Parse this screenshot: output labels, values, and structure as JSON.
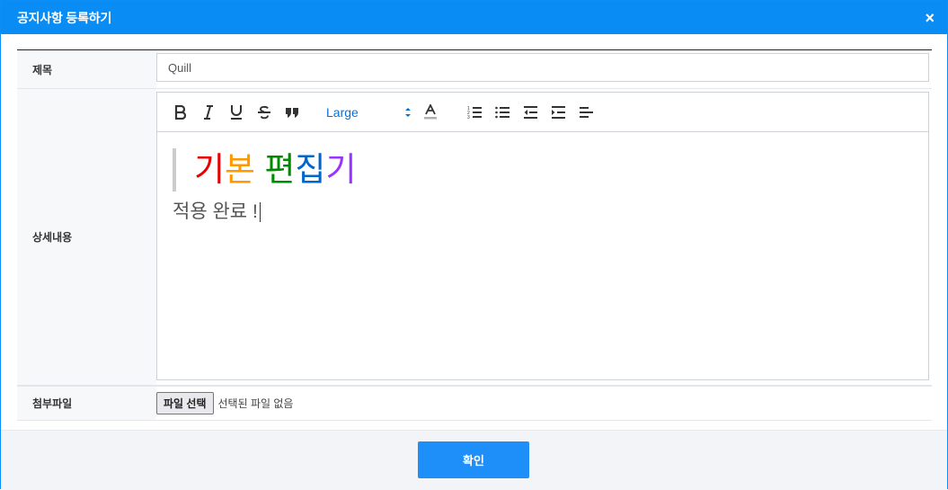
{
  "modal": {
    "title": "공지사항 등록하기",
    "close_glyph": "×"
  },
  "form": {
    "title_label": "제목",
    "title_value": "Quill",
    "content_label": "상세내용",
    "attachment_label": "첨부파일"
  },
  "toolbar": {
    "size_selected": "Large",
    "icons": [
      "bold-icon",
      "italic-icon",
      "underline-icon",
      "strike-icon",
      "blockquote-icon",
      "font-color-icon",
      "ordered-list-icon",
      "bullet-list-icon",
      "outdent-icon",
      "indent-icon",
      "align-icon"
    ]
  },
  "editor": {
    "quote_chars": [
      {
        "text": "기",
        "color": "#e60000"
      },
      {
        "text": "본",
        "color": "#ff9900"
      },
      {
        "text": " ",
        "color": "#000000"
      },
      {
        "text": "편",
        "color": "#008a00"
      },
      {
        "text": "집",
        "color": "#0066cc"
      },
      {
        "text": "기",
        "color": "#9933ff"
      }
    ],
    "paragraph": "적용 완료 !"
  },
  "file": {
    "button_label": "파일 선택",
    "status": "선택된 파일 없음"
  },
  "footer": {
    "confirm_label": "확인"
  }
}
